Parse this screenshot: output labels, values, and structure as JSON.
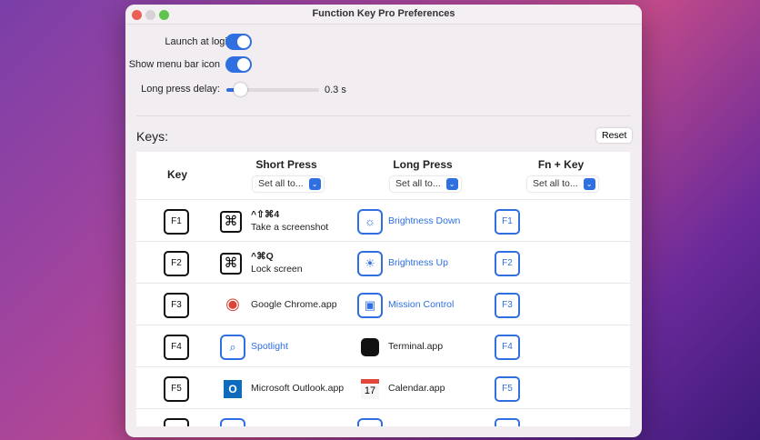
{
  "window": {
    "title": "Function Key Pro Preferences"
  },
  "settings": {
    "launch_at_login": "Launch at login",
    "show_menu_bar_icon": "Show menu bar icon",
    "long_press_delay_label": "Long press delay:",
    "long_press_delay_value": "0.3 s",
    "long_press_delay_fraction": 0.12
  },
  "keys": {
    "title": "Keys:",
    "reset": "Reset",
    "columns": {
      "key": "Key",
      "short": "Short Press",
      "long": "Long Press",
      "fn": "Fn + Key"
    },
    "set_all": "Set all to...",
    "rows": [
      {
        "key": "F1",
        "short": {
          "icon": "command-icon",
          "style": "box",
          "glyph": "⌘",
          "shortcut": "^⇧⌘4",
          "label": "Take a screenshot"
        },
        "long": {
          "icon": "brightness-down-icon",
          "style": "blue",
          "glyph": "☼",
          "label": "Brightness Down"
        },
        "fn": "F1"
      },
      {
        "key": "F2",
        "short": {
          "icon": "command-icon",
          "style": "box",
          "glyph": "⌘",
          "shortcut": "^⌘Q",
          "label": "Lock screen"
        },
        "long": {
          "icon": "brightness-up-icon",
          "style": "blue",
          "glyph": "☀",
          "label": "Brightness Up"
        },
        "fn": "F2"
      },
      {
        "key": "F3",
        "short": {
          "icon": "chrome-icon",
          "style": "app",
          "glyph": "◉",
          "label": "Google Chrome.app"
        },
        "long": {
          "icon": "mission-control-icon",
          "style": "blue",
          "glyph": "▣",
          "label": "Mission Control"
        },
        "fn": "F3"
      },
      {
        "key": "F4",
        "short": {
          "icon": "spotlight-icon",
          "style": "blue",
          "glyph": "⌕",
          "label": "Spotlight"
        },
        "long": {
          "icon": "terminal-icon",
          "style": "app",
          "glyph": "▪",
          "label": "Terminal.app"
        },
        "fn": "F4"
      },
      {
        "key": "F5",
        "short": {
          "icon": "outlook-icon",
          "style": "app",
          "glyph": "O",
          "label": "Microsoft Outlook.app"
        },
        "long": {
          "icon": "calendar-icon",
          "style": "app",
          "glyph": "17",
          "label": "Calendar.app"
        },
        "fn": "F5"
      },
      {
        "key": "",
        "short": {
          "icon": "action-icon",
          "style": "blue",
          "glyph": "",
          "label": ""
        },
        "long": {
          "icon": "action-icon",
          "style": "blue",
          "glyph": "",
          "label": ""
        },
        "fn": ""
      }
    ]
  },
  "colors": {
    "accent": "#2f6fe0"
  }
}
